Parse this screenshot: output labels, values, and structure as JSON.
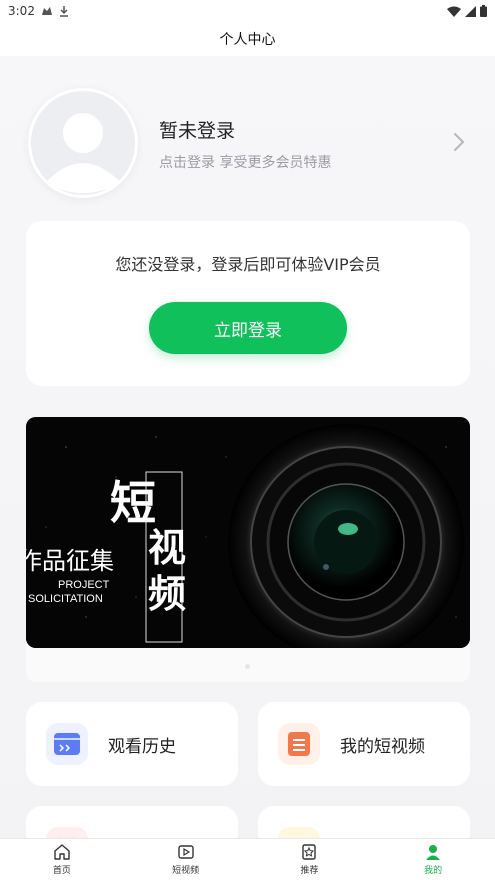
{
  "status_bar": {
    "time": "3:02"
  },
  "header": {
    "title": "个人中心"
  },
  "profile": {
    "name": "暂未登录",
    "subtitle": "点击登录 享受更多会员特惠"
  },
  "login_card": {
    "tip": "您还没登录，登录后即可体验VIP会员",
    "button_label": "立即登录"
  },
  "banner": {
    "text_main": "短",
    "text_vertical": "视频",
    "text_left": "作品征集",
    "text_project": "PROJECT",
    "text_solicitation": "SOLICITATION"
  },
  "tiles": [
    {
      "label": "观看历史",
      "icon": "history-icon",
      "color": "#5b7cf5"
    },
    {
      "label": "我的短视频",
      "icon": "video-list-icon",
      "color": "#f2784b"
    },
    {
      "label": "",
      "icon": "heart-icon",
      "color": "#f06a5a"
    },
    {
      "label": "",
      "icon": "folder-icon",
      "color": "#f5c542"
    }
  ],
  "bottom_nav": [
    {
      "label": "首页",
      "icon": "home-icon"
    },
    {
      "label": "短视频",
      "icon": "play-icon"
    },
    {
      "label": "推荐",
      "icon": "recommend-icon"
    },
    {
      "label": "我的",
      "icon": "user-icon",
      "active": true
    }
  ],
  "colors": {
    "accent": "#10c05a",
    "nav_active": "#17b24d"
  }
}
